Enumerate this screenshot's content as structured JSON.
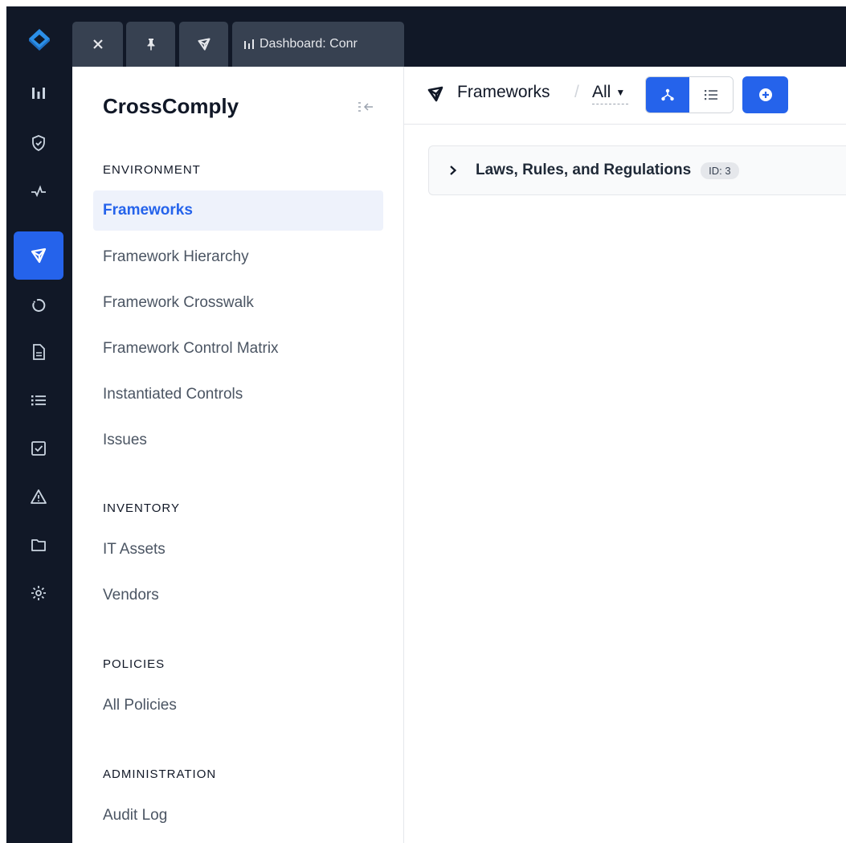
{
  "brand": {
    "name": "CrossComply"
  },
  "tabs": [
    {
      "icon": "close-icon"
    },
    {
      "icon": "pin-icon"
    },
    {
      "icon": "frameworks-icon"
    },
    {
      "icon": "chart-icon",
      "label": "Dashboard: Conr"
    }
  ],
  "rail": {
    "items": [
      {
        "icon": "chart-icon"
      },
      {
        "icon": "shield-icon"
      },
      {
        "icon": "activity-icon"
      },
      {
        "icon": "frameworks-icon",
        "active": true
      },
      {
        "icon": "circle-icon"
      },
      {
        "icon": "document-icon"
      },
      {
        "icon": "list-icon"
      },
      {
        "icon": "checkbox-icon"
      },
      {
        "icon": "warning-icon"
      },
      {
        "icon": "folder-icon"
      },
      {
        "icon": "gear-icon"
      }
    ]
  },
  "sidebar": {
    "sections": {
      "environment": "ENVIRONMENT",
      "inventory": "INVENTORY",
      "policies": "POLICIES",
      "administration": "ADMINISTRATION"
    },
    "items": {
      "frameworks": "Frameworks",
      "hierarchy": "Framework Hierarchy",
      "crosswalk": "Framework Crosswalk",
      "matrix": "Framework Control Matrix",
      "instantiated": "Instantiated Controls",
      "issues": "Issues",
      "it_assets": "IT Assets",
      "vendors": "Vendors",
      "all_policies": "All Policies",
      "audit_log": "Audit Log"
    },
    "active": "frameworks"
  },
  "toolbar": {
    "breadcrumb": "Frameworks",
    "separator": "/",
    "scope": "All",
    "view_mode": "tree"
  },
  "rows": [
    {
      "title": "Laws, Rules, and Regulations",
      "badge": "ID: 3"
    }
  ],
  "colors": {
    "accent": "#2563eb",
    "rail": "#111827",
    "tab": "#374151"
  }
}
